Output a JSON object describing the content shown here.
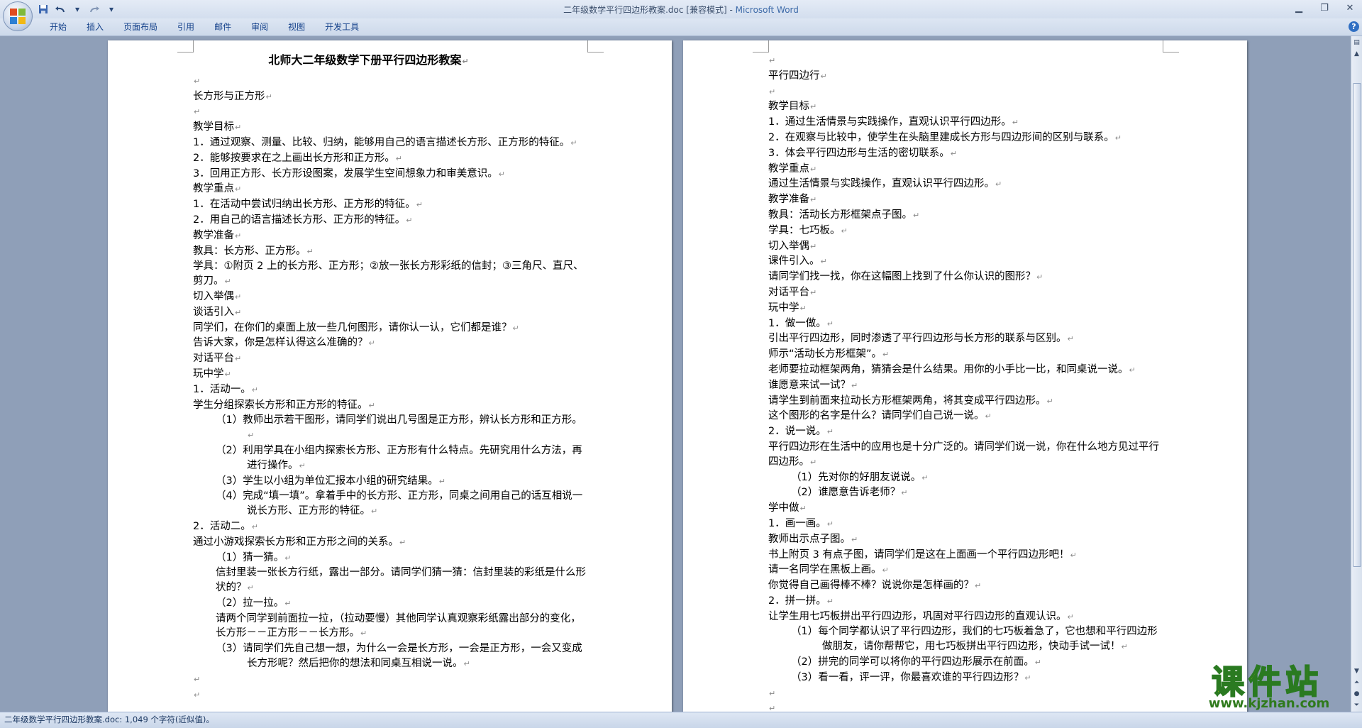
{
  "window": {
    "title_doc": "二年级数学平行四边形教案.doc [兼容模式] - ",
    "title_app": "Microsoft Word"
  },
  "quick_access": {
    "save_icon": "save-icon",
    "undo_icon": "undo-icon",
    "redo_icon": "redo-icon",
    "customize_icon": "dropdown-icon"
  },
  "ribbon_tabs": [
    "开始",
    "插入",
    "页面布局",
    "引用",
    "邮件",
    "审阅",
    "视图",
    "开发工具"
  ],
  "help_glyph": "?",
  "page1": {
    "paragraphs": [
      "北师大二年级数学下册平行四边形教案",
      "",
      "长方形与正方形",
      "",
      "教学目标",
      "1．通过观察、测量、比较、归纳，能够用自己的语言描述长方形、正方形的特征。",
      "2．能够按要求在之上画出长方形和正方形。",
      "3．回用正方形、长方形设图案，发展学生空间想象力和审美意识。",
      "教学重点",
      "1．在活动中尝试归纳出长方形、正方形的特征。",
      "2．用自己的语言描述长方形、正方形的特征。",
      "教学准备",
      "教具：长方形、正方形。",
      "学具：①附页 2 上的长方形、正方形；②放一张长方形彩纸的信封；③三角尺、直尺、剪刀。",
      "切入举偶",
      "谈话引入",
      "同学们，在你们的桌面上放一些几何图形，请你认一认，它们都是谁？",
      "告诉大家，你是怎样认得这么准确的？",
      "对话平台",
      "玩中学",
      "1．活动一。",
      "学生分组探索长方形和正方形的特征。",
      "（1）教师出示若干图形，请同学们说出几号图是正方形，辨认长方形和正方形。",
      "（2）利用学具在小组内探索长方形、正方形有什么特点。先研究用什么方法，再进行操作。",
      "（3）学生以小组为单位汇报本小组的研究结果。",
      "（4）完成“填一填”。拿着手中的长方形、正方形，同桌之间用自己的话互相说一说长方形、正方形的特征。",
      "2．活动二。",
      "通过小游戏探索长方形和正方形之间的关系。",
      "（1）猜一猜。",
      "信封里装一张长方行纸，露出一部分。请同学们猜一猜：信封里装的彩纸是什么形状的？",
      "（2）拉一拉。",
      "请两个同学到前面拉一拉，（拉动要慢）其他同学认真观察彩纸露出部分的变化，长方形－－正方形－－长方形。",
      "（3）请同学们先自己想一想，为什么一会是长方形，一会是正方形，一会又变成长方形呢？然后把你的想法和同桌互相说一说。",
      "",
      ""
    ]
  },
  "page2": {
    "paragraphs": [
      "",
      "平行四边行",
      "",
      "教学目标",
      "1．通过生活情景与实践操作，直观认识平行四边形。",
      "2．在观察与比较中，使学生在头脑里建成长方形与四边形间的区别与联系。",
      "3．体会平行四边形与生活的密切联系。",
      "教学重点",
      "通过生活情景与实践操作，直观认识平行四边形。",
      "教学准备",
      "教具：活动长方形框架点子图。",
      "学具：七巧板。",
      "切入举偶",
      "课件引入。",
      "请同学们找一找，你在这幅图上找到了什么你认识的图形？",
      "对话平台",
      "玩中学",
      "1．做一做。",
      "引出平行四边形，同时渗透了平行四边形与长方形的联系与区别。",
      "师示“活动长方形框架”。",
      "老师要拉动框架两角，猜猜会是什么结果。用你的小手比一比，和同桌说一说。",
      "谁愿意来试一试？",
      "请学生到前面来拉动长方形框架两角，将其变成平行四边形。",
      "这个图形的名字是什么？请同学们自己说一说。",
      "2．说一说。",
      "平行四边形在生活中的应用也是十分广泛的。请同学们说一说，你在什么地方见过平行四边形。",
      "（1）先对你的好朋友说说。",
      "（2）谁愿意告诉老师？",
      "学中做",
      "1．画一画。",
      "教师出示点子图。",
      "书上附页 3 有点子图，请同学们是这在上面画一个平行四边形吧！",
      "请一名同学在黑板上画。",
      "你觉得自己画得棒不棒？说说你是怎样画的？",
      "2．拼一拼。",
      "让学生用七巧板拼出平行四边形，巩固对平行四边形的直观认识。",
      "（1）每个同学都认识了平行四边形，我们的七巧板着急了，它也想和平行四边形做朋友，请你帮帮它，用七巧板拼出平行四边形，快动手试一试！",
      "（2）拼完的同学可以将你的平行四边形展示在前面。",
      "（3）看一看，评一评，你最喜欢谁的平行四边形？",
      "",
      "",
      ""
    ]
  },
  "status": {
    "text": "二年级数学平行四边形教案.doc: 1,049 个字符(近似值)。"
  },
  "watermark": {
    "main": "课件站",
    "url": "www.kjzhan.com"
  },
  "paragraph_mark": "↵"
}
